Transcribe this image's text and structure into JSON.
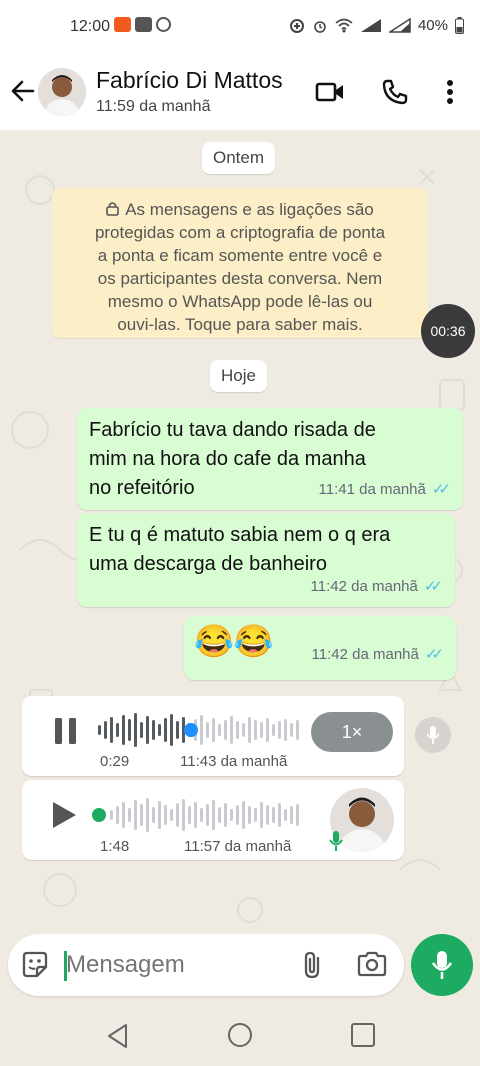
{
  "status_bar": {
    "time": "12:00",
    "battery": "40%"
  },
  "header": {
    "contact_name": "Fabrício Di Mattos",
    "last_seen": "11:59 da manhã"
  },
  "date_separators": {
    "yesterday": "Ontem",
    "today": "Hoje"
  },
  "encryption_notice": {
    "lines": [
      "As mensagens e as ligações são",
      "protegidas com a criptografia de ponta",
      "a ponta e ficam somente entre você e",
      "os participantes desta conversa. Nem",
      "mesmo o WhatsApp pode lê-las ou",
      "ouvi-las. Toque para saber mais."
    ]
  },
  "recording_timer": "00:36",
  "messages": [
    {
      "type": "text",
      "direction": "outgoing",
      "lines": [
        "Fabrício tu tava dando risada de",
        "mim na hora do cafe da manha",
        "no refeitório"
      ],
      "time": "11:41 da manhã",
      "status": "read"
    },
    {
      "type": "text",
      "direction": "outgoing",
      "lines": [
        "E tu q é matuto sabia nem o q era",
        "uma descarga de banheiro"
      ],
      "time": "11:42 da manhã",
      "status": "read"
    },
    {
      "type": "text",
      "direction": "outgoing",
      "text": "😂😂",
      "time": "11:42 da manhã",
      "status": "read"
    }
  ],
  "voice_notes": [
    {
      "direction": "incoming",
      "state": "playing",
      "elapsed": "0:29",
      "time": "11:43 da manhã",
      "speed": "1×",
      "progress": 0.45
    },
    {
      "direction": "incoming",
      "state": "paused",
      "duration": "1:48",
      "time": "11:57 da manhã",
      "progress": 0.0
    }
  ],
  "composer": {
    "placeholder": "Mensagem"
  },
  "colors": {
    "accent": "#1daa61",
    "outgoing_bubble": "#d9fdd3",
    "read_ticks": "#53bdeb",
    "notice_bg": "#fcefc7",
    "play_dot": "#1f8fff"
  },
  "icons": {
    "back": "arrow-left-icon",
    "video": "video-call-icon",
    "call": "phone-icon",
    "menu": "more-vert-icon",
    "lock": "lock-icon",
    "pause": "pause-icon",
    "play": "play-icon",
    "mic": "mic-icon",
    "sticker": "sticker-icon",
    "attach": "paperclip-icon",
    "camera": "camera-icon"
  }
}
